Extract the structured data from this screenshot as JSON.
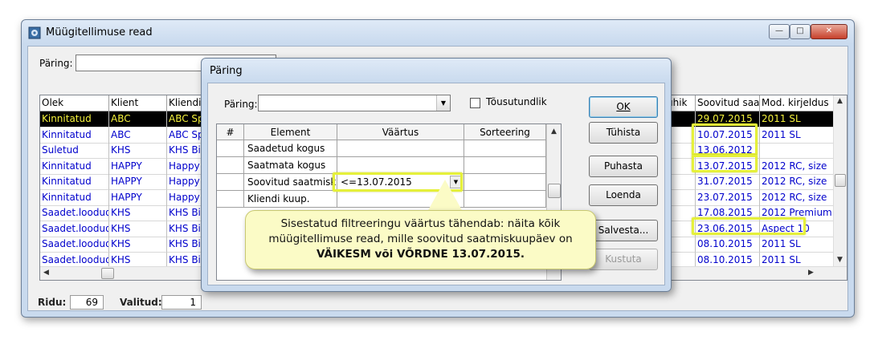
{
  "main_window": {
    "title": "Müügitellimuse read",
    "min_glyph": "—",
    "max_glyph": "□",
    "close_glyph": "✕"
  },
  "query": {
    "label": "Päring:",
    "value": ""
  },
  "table": {
    "columns": [
      "Olek",
      "Klient",
      "Kliendi",
      "ühik",
      "Soovitud saatm",
      "Mod. kirjeldus"
    ],
    "rows": [
      {
        "olek": "Kinnitatud",
        "klient": "ABC",
        "kliendi": "ABC Sp",
        "date": "29.07.2015",
        "mod": "2011 SL",
        "selected": true
      },
      {
        "olek": "Kinnitatud",
        "klient": "ABC",
        "kliendi": "ABC Sp",
        "date": "10.07.2015",
        "mod": "2011 SL"
      },
      {
        "olek": "Suletud",
        "klient": "KHS",
        "kliendi": "KHS Bi",
        "date": "13.06.2012",
        "mod": ""
      },
      {
        "olek": "Kinnitatud",
        "klient": "HAPPY",
        "kliendi": "Happy",
        "date": "13.07.2015",
        "mod": "2012 RC, size"
      },
      {
        "olek": "Kinnitatud",
        "klient": "HAPPY",
        "kliendi": "Happy",
        "date": "31.07.2015",
        "mod": "2012 RC, size"
      },
      {
        "olek": "Kinnitatud",
        "klient": "HAPPY",
        "kliendi": "Happy",
        "date": "23.07.2015",
        "mod": "2012 RC, size"
      },
      {
        "olek": "Saadet.loodud",
        "klient": "KHS",
        "kliendi": "KHS Bi",
        "date": "17.08.2015",
        "mod": "2012 Premium"
      },
      {
        "olek": "Saadet.loodud",
        "klient": "KHS",
        "kliendi": "KHS Bi",
        "date": "23.06.2015",
        "mod": "Aspect 10"
      },
      {
        "olek": "Saadet.loodud",
        "klient": "KHS",
        "kliendi": "KHS Bi",
        "date": "08.10.2015",
        "mod": "2011 SL"
      },
      {
        "olek": "Saadet.loodud",
        "klient": "KHS",
        "kliendi": "KHS Bi",
        "date": "08.10.2015",
        "mod": "2011 SL"
      }
    ]
  },
  "status": {
    "rows_label": "Ridu:",
    "rows_value": "69",
    "selected_label": "Valitud:",
    "selected_value": "1"
  },
  "dialog": {
    "title": "Päring",
    "paring_label": "Päring:",
    "combo_value": "",
    "checkbox_label": "Tõusutundlik",
    "checkbox_checked": false,
    "grid_headers": [
      "#",
      "Element",
      "Väärtus",
      "Sorteering"
    ],
    "grid_rows": [
      {
        "element": "Saadetud kogus",
        "value": "",
        "sort": ""
      },
      {
        "element": "Saatmata kogus",
        "value": "",
        "sort": ""
      },
      {
        "element": "Soovitud saatmiskuu",
        "value": "<=13.07.2015",
        "sort": ""
      },
      {
        "element": "Kliendi kuup.",
        "value": "",
        "sort": ""
      }
    ],
    "buttons": {
      "ok": "OK",
      "cancel": "Tühista",
      "clear": "Puhasta",
      "load": "Loenda",
      "save": "Salvesta...",
      "delete": "Kustuta"
    }
  },
  "callout": {
    "line1": "Sisestatud filtreeringu väärtus tähendab: näita kõik",
    "line2": "müügitellimuse read, mille soovitud saatmiskuupäev on",
    "line3": "VÄIKESM või VÕRDNE 13.07.2015."
  },
  "colors": {
    "highlight": "#e5f03a",
    "selected_row_text": "#f5f23c",
    "link_blue": "#0000cc"
  }
}
